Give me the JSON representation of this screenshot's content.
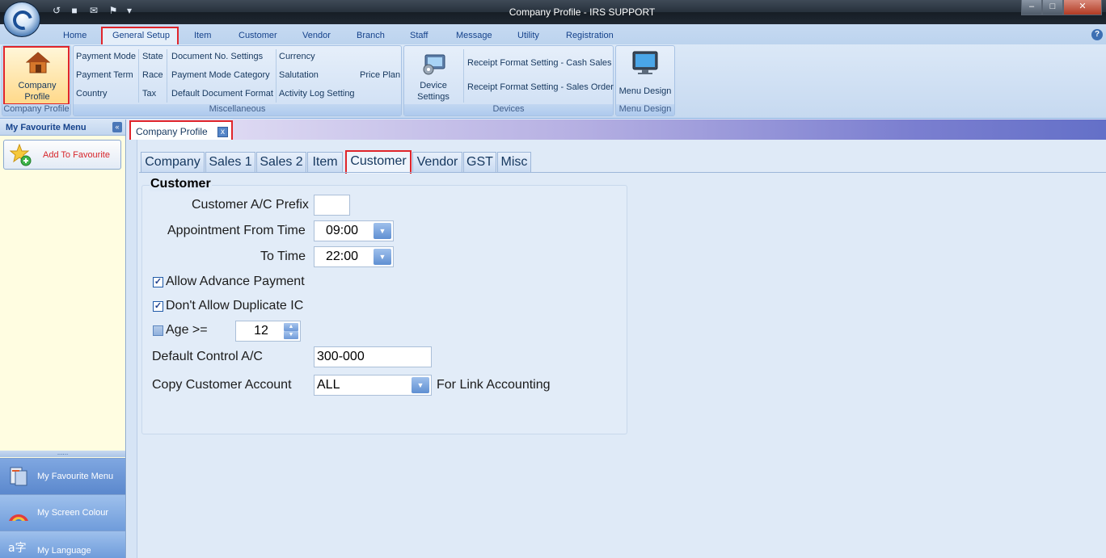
{
  "window": {
    "title": "Company Profile - IRS SUPPORT",
    "minimize": "–",
    "maximize": "□",
    "close": "✕"
  },
  "quick_access": [
    "↺",
    "■",
    "✉",
    "⚑",
    "▾"
  ],
  "ribbon_tabs": [
    "Home",
    "General Setup",
    "Item",
    "Customer",
    "Vendor",
    "Branch",
    "Staff",
    "Message",
    "Utility",
    "Registration"
  ],
  "active_ribbon_tab": "General Setup",
  "help": "?",
  "ribbon": {
    "company_profile": {
      "label_line1": "Company",
      "label_line2": "Profile",
      "group": "Company Profile"
    },
    "misc": {
      "group": "Miscellaneous",
      "col1": [
        "Payment Mode",
        "Payment Term",
        "Country"
      ],
      "col2": [
        "State",
        "Race",
        "Tax"
      ],
      "col3": [
        "Document No. Settings",
        "Payment Mode Category",
        "Default Document Format"
      ],
      "col4": [
        "Currency",
        "Salutation",
        "Activity Log Setting"
      ],
      "price_plan": "Price Plan"
    },
    "devices": {
      "group": "Devices",
      "device_line1": "Device",
      "device_line2": "Settings",
      "receipt_cash": "Receipt Format Setting - Cash  Sales",
      "receipt_order": "Receipt Format Setting - Sales Order"
    },
    "menu_design": {
      "label": "Menu Design",
      "group": "Menu Design"
    }
  },
  "favourite": {
    "title": "My Favourite Menu",
    "collapse": "«",
    "add": "Add To Favourite",
    "splitter": "......",
    "nav": [
      "My Favourite Menu",
      "My Screen Colour",
      "My Language"
    ]
  },
  "doc_tab": {
    "label": "Company Profile",
    "close": "x"
  },
  "page_tabs": [
    "Company",
    "Sales 1",
    "Sales 2",
    "Item",
    "Customer",
    "Vendor",
    "GST",
    "Misc"
  ],
  "active_page_tab": "Customer",
  "customer": {
    "title": "Customer",
    "prefix_label": "Customer A/C Prefix",
    "prefix_value": "",
    "appt_from_label": "Appointment From Time",
    "appt_from_value": "09:00",
    "to_time_label": "To Time",
    "to_time_value": "22:00",
    "allow_advance_label": "Allow Advance Payment",
    "allow_advance_checked": true,
    "no_dup_ic_label": "Don't Allow Duplicate IC",
    "no_dup_ic_checked": true,
    "age_label": "Age >=",
    "age_checked": false,
    "age_value": "12",
    "default_ctrl_label": "Default Control A/C",
    "default_ctrl_value": "300-000",
    "copy_label": "Copy Customer Account",
    "copy_value": "ALL",
    "link_label": "For Link Accounting"
  }
}
